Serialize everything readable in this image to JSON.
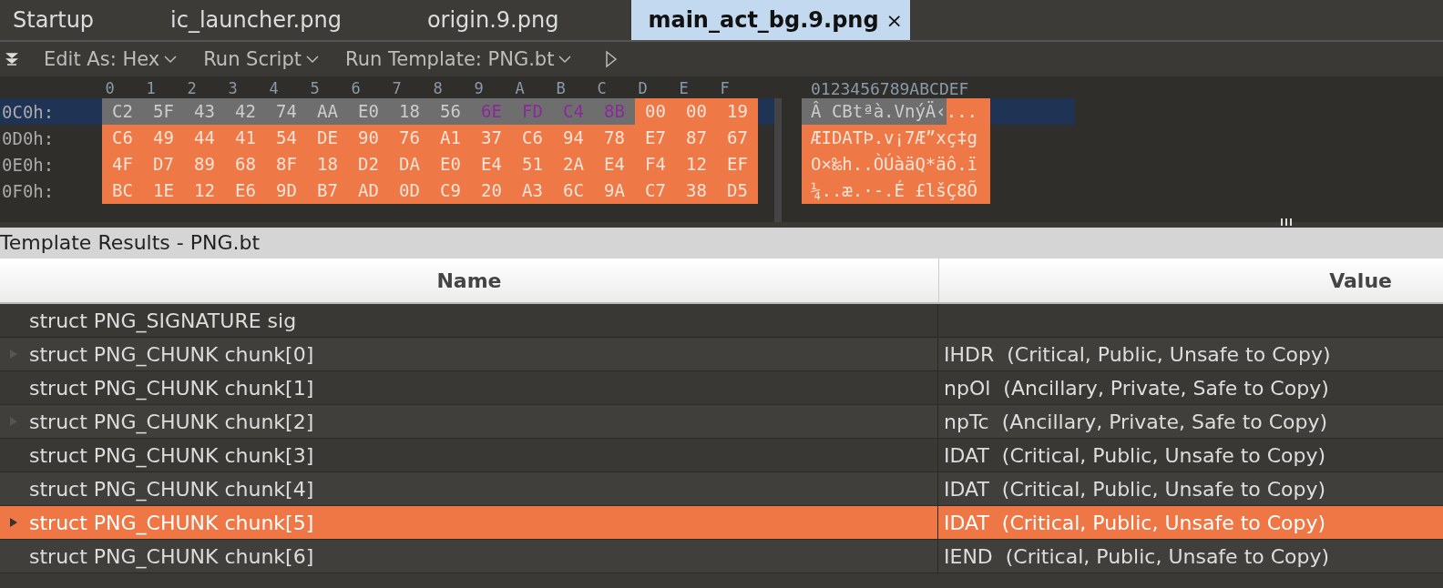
{
  "tabs": [
    {
      "label": "Startup",
      "selected": false
    },
    {
      "label": "ic_launcher.png",
      "selected": false
    },
    {
      "label": "origin.9.png",
      "selected": false
    },
    {
      "label": "main_act_bg.9.png",
      "selected": true,
      "close": "×"
    }
  ],
  "toolbar": [
    {
      "label": "Edit As: Hex"
    },
    {
      "label": "Run Script"
    },
    {
      "label": "Run Template: PNG.bt"
    }
  ],
  "hex": {
    "columns": [
      "0",
      "1",
      "2",
      "3",
      "4",
      "5",
      "6",
      "7",
      "8",
      "9",
      "A",
      "B",
      "C",
      "D",
      "E",
      "F"
    ],
    "ascii_header": "0123456789ABCDEF",
    "rows": [
      {
        "address": "0C0h:",
        "current": true,
        "bytes": [
          {
            "v": "C2",
            "kind": "selection"
          },
          {
            "v": "5F",
            "kind": "selection"
          },
          {
            "v": "43",
            "kind": "selection"
          },
          {
            "v": "42",
            "kind": "selection"
          },
          {
            "v": "74",
            "kind": "selection"
          },
          {
            "v": "AA",
            "kind": "selection"
          },
          {
            "v": "E0",
            "kind": "selection"
          },
          {
            "v": "18",
            "kind": "selection"
          },
          {
            "v": "56",
            "kind": "selection"
          },
          {
            "v": "6E",
            "kind": "marked"
          },
          {
            "v": "FD",
            "kind": "marked"
          },
          {
            "v": "C4",
            "kind": "marked"
          },
          {
            "v": "8B",
            "kind": "marked"
          },
          {
            "v": "00",
            "kind": "template"
          },
          {
            "v": "00",
            "kind": "template"
          },
          {
            "v": "19",
            "kind": "template"
          }
        ],
        "ascii": [
          {
            "text": "Â CBtªà.V",
            "kind": "selection"
          },
          {
            "text": "nýÄ‹",
            "kind": "marked"
          },
          {
            "text": "...",
            "kind": "template"
          }
        ]
      },
      {
        "address": "0D0h:",
        "current": false,
        "bytes": [
          {
            "v": "C6",
            "kind": "template"
          },
          {
            "v": "49",
            "kind": "template"
          },
          {
            "v": "44",
            "kind": "template"
          },
          {
            "v": "41",
            "kind": "template"
          },
          {
            "v": "54",
            "kind": "template"
          },
          {
            "v": "DE",
            "kind": "template"
          },
          {
            "v": "90",
            "kind": "template"
          },
          {
            "v": "76",
            "kind": "template"
          },
          {
            "v": "A1",
            "kind": "template"
          },
          {
            "v": "37",
            "kind": "template"
          },
          {
            "v": "C6",
            "kind": "template"
          },
          {
            "v": "94",
            "kind": "template"
          },
          {
            "v": "78",
            "kind": "template"
          },
          {
            "v": "E7",
            "kind": "template"
          },
          {
            "v": "87",
            "kind": "template"
          },
          {
            "v": "67",
            "kind": "template"
          }
        ],
        "ascii": [
          {
            "text": "ÆIDATÞ.v¡7Æ”xç‡g",
            "kind": "template"
          }
        ]
      },
      {
        "address": "0E0h:",
        "current": false,
        "bytes": [
          {
            "v": "4F",
            "kind": "template"
          },
          {
            "v": "D7",
            "kind": "template"
          },
          {
            "v": "89",
            "kind": "template"
          },
          {
            "v": "68",
            "kind": "template"
          },
          {
            "v": "8F",
            "kind": "template"
          },
          {
            "v": "18",
            "kind": "template"
          },
          {
            "v": "D2",
            "kind": "template"
          },
          {
            "v": "DA",
            "kind": "template"
          },
          {
            "v": "E0",
            "kind": "template"
          },
          {
            "v": "E4",
            "kind": "template"
          },
          {
            "v": "51",
            "kind": "template"
          },
          {
            "v": "2A",
            "kind": "template"
          },
          {
            "v": "E4",
            "kind": "template"
          },
          {
            "v": "F4",
            "kind": "template"
          },
          {
            "v": "12",
            "kind": "template"
          },
          {
            "v": "EF",
            "kind": "template"
          }
        ],
        "ascii": [
          {
            "text": "O×‰h..ÒÚàäQ*äô.ï",
            "kind": "template"
          }
        ]
      },
      {
        "address": "0F0h:",
        "current": false,
        "bytes": [
          {
            "v": "BC",
            "kind": "template"
          },
          {
            "v": "1E",
            "kind": "template"
          },
          {
            "v": "12",
            "kind": "template"
          },
          {
            "v": "E6",
            "kind": "template"
          },
          {
            "v": "9D",
            "kind": "template"
          },
          {
            "v": "B7",
            "kind": "template"
          },
          {
            "v": "AD",
            "kind": "template"
          },
          {
            "v": "0D",
            "kind": "template"
          },
          {
            "v": "C9",
            "kind": "template"
          },
          {
            "v": "20",
            "kind": "template"
          },
          {
            "v": "A3",
            "kind": "template"
          },
          {
            "v": "6C",
            "kind": "template"
          },
          {
            "v": "9A",
            "kind": "template"
          },
          {
            "v": "C7",
            "kind": "template"
          },
          {
            "v": "38",
            "kind": "template"
          },
          {
            "v": "D5",
            "kind": "template"
          }
        ],
        "ascii": [
          {
            "text": "¼..æ.·-.É £lšÇ8Õ",
            "kind": "template"
          }
        ]
      }
    ]
  },
  "results": {
    "title": "Template Results - PNG.bt",
    "columns": [
      "Name",
      "Value"
    ],
    "rows": [
      {
        "name": "struct PNG_SIGNATURE sig",
        "value": "",
        "expandable": false,
        "selected": false
      },
      {
        "name": "struct PNG_CHUNK chunk[0]",
        "value": "IHDR  (Critical, Public, Unsafe to Copy)",
        "expandable": true,
        "selected": false
      },
      {
        "name": "struct PNG_CHUNK chunk[1]",
        "value": "npOl  (Ancillary, Private, Safe to Copy)",
        "expandable": false,
        "selected": false
      },
      {
        "name": "struct PNG_CHUNK chunk[2]",
        "value": "npTc  (Ancillary, Private, Safe to Copy)",
        "expandable": true,
        "selected": false
      },
      {
        "name": "struct PNG_CHUNK chunk[3]",
        "value": "IDAT  (Critical, Public, Unsafe to Copy)",
        "expandable": false,
        "selected": false
      },
      {
        "name": "struct PNG_CHUNK chunk[4]",
        "value": "IDAT  (Critical, Public, Unsafe to Copy)",
        "expandable": false,
        "selected": false
      },
      {
        "name": "struct PNG_CHUNK chunk[5]",
        "value": "IDAT  (Critical, Public, Unsafe to Copy)",
        "expandable": true,
        "selected": true
      },
      {
        "name": "struct PNG_CHUNK chunk[6]",
        "value": "IEND  (Critical, Public, Unsafe to Copy)",
        "expandable": false,
        "selected": false
      }
    ]
  }
}
